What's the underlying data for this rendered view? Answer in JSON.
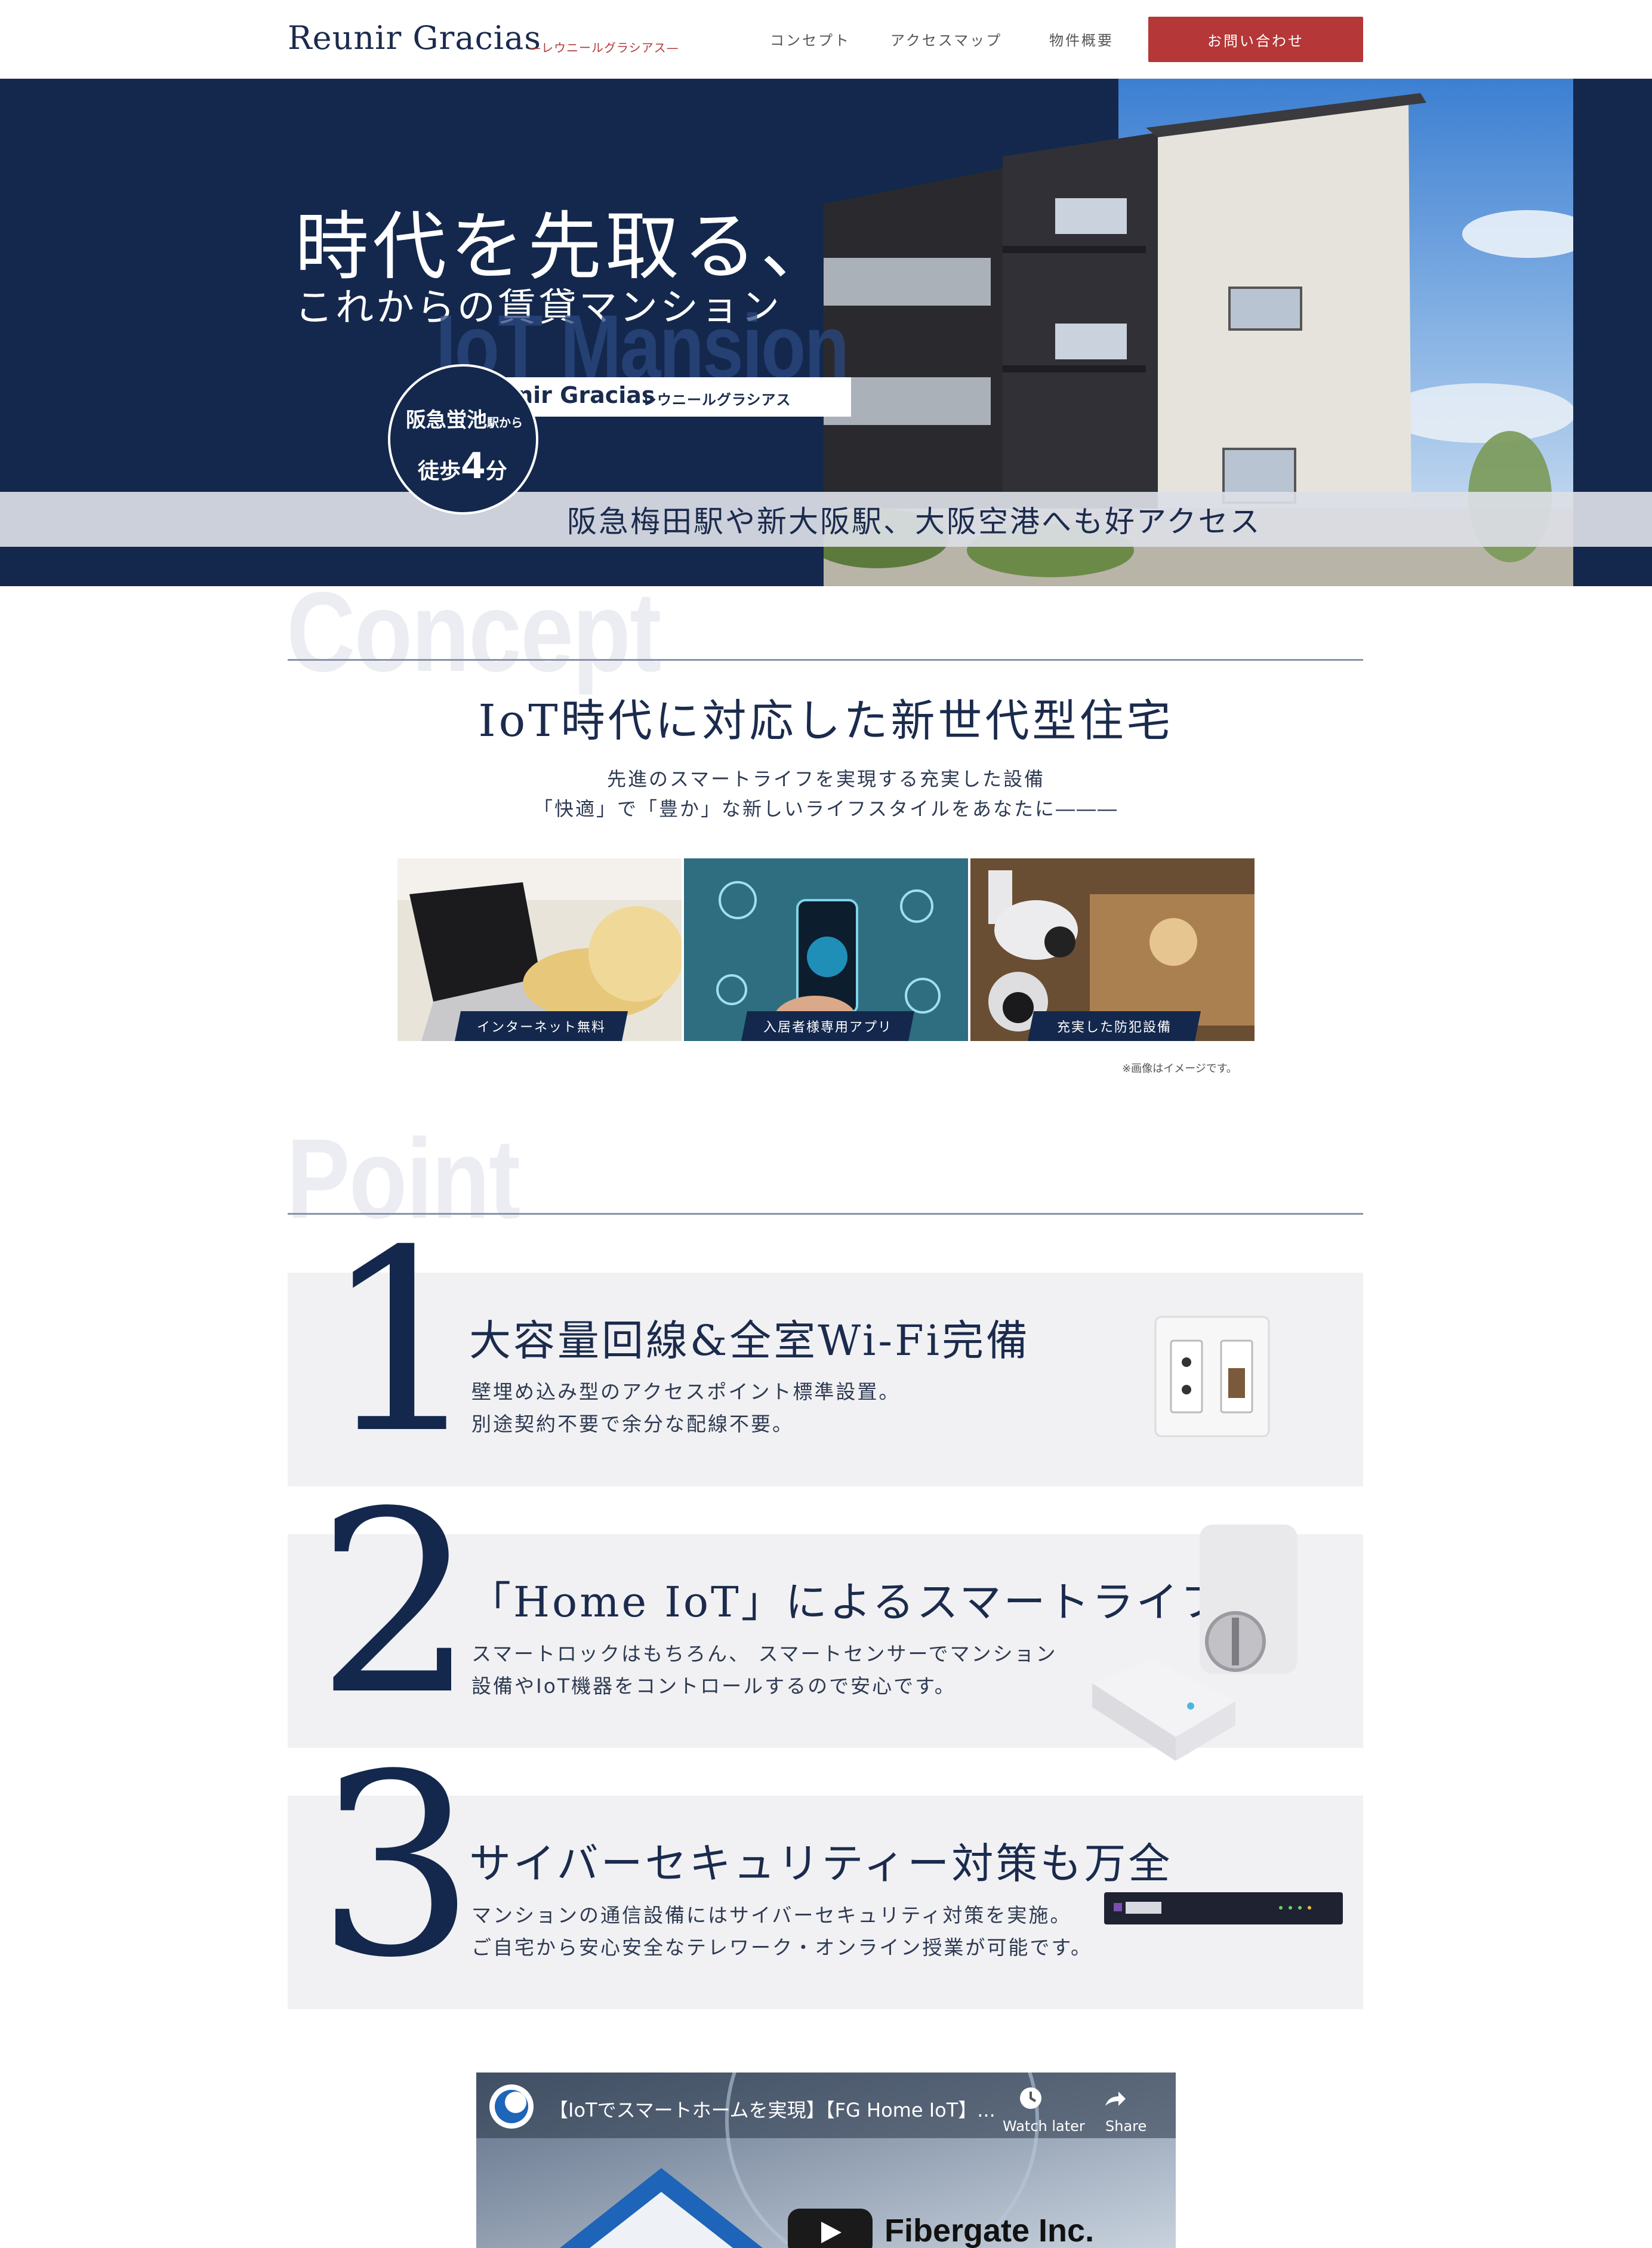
{
  "header": {
    "logo": "Reunir Gracias",
    "logo_sub": "—レウニールグラシアス—",
    "nav": [
      "コンセプト",
      "アクセスマップ",
      "物件概要"
    ],
    "contact_label": "お問い合わせ"
  },
  "hero": {
    "copy_line1": "時代を先取る、",
    "copy_line2": "これからの賃貸マンション",
    "iot_text": "IoT Mansion",
    "brand_name": "Reunir Gracias",
    "brand_kana": "レウニールグラシアス",
    "badge_station": "阪急蛍池",
    "badge_from": "駅から",
    "badge_walk": "徒歩",
    "badge_minutes": "4",
    "badge_unit": "分",
    "access": "阪急梅田駅や新大阪駅、大阪空港へも好アクセス"
  },
  "concept": {
    "heading_ghost": "Concept",
    "title": "IoT時代に対応した新世代型住宅",
    "lead_line1": "先進のスマートライフを実現する充実した設備",
    "lead_line2": "「快適」で「豊か」な新しいライフスタイルをあなたに―――",
    "cards": [
      {
        "caption": "インターネット無料"
      },
      {
        "caption": "入居者様専用アプリ"
      },
      {
        "caption": "充実した防犯設備"
      }
    ],
    "note": "※画像はイメージです。"
  },
  "points": {
    "heading_ghost": "Point",
    "items": [
      {
        "number": "1",
        "title": "大容量回線&全室Wi-Fi完備",
        "desc_line1": "壁埋め込み型のアクセスポイント標準設置。",
        "desc_line2": "別途契約不要で余分な配線不要。"
      },
      {
        "number": "2",
        "title": "「Home IoT」によるスマートライフ",
        "desc_line1": "スマートロックはもちろん、 スマートセンサーでマンション",
        "desc_line2": "設備やIoT機器をコントロールするので安心です。"
      },
      {
        "number": "3",
        "title": "サイバーセキュリティー対策も万全",
        "desc_line1": "マンションの通信設備にはサイバーセキュリティ対策を実施。",
        "desc_line2": "ご自宅から安心安全なテレワーク・オンライン授業が可能です。"
      }
    ]
  },
  "video": {
    "title": "【IoTでスマートホームを実現】【FG Home IoT】...",
    "watch_later": "Watch later",
    "share": "Share",
    "brand": "Fibergate Inc."
  }
}
